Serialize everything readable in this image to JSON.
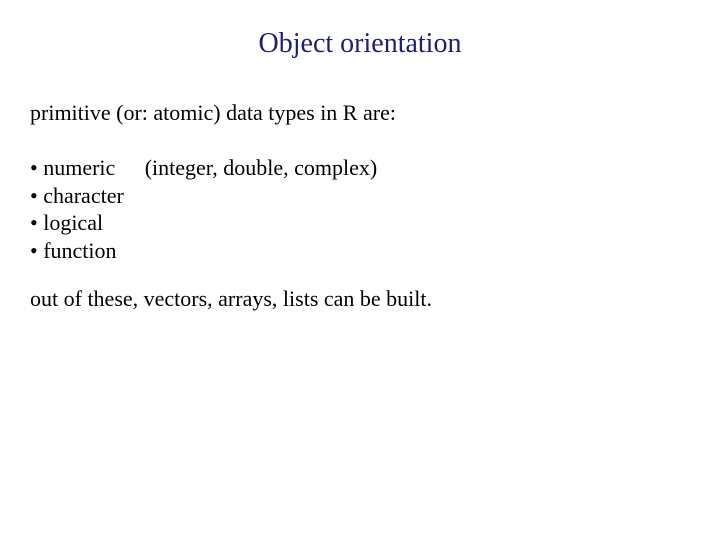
{
  "title": "Object orientation",
  "intro": "primitive (or: atomic) data types in R are:",
  "items": {
    "0": {
      "label": "numeric",
      "note": "(integer, double, complex)"
    },
    "1": {
      "label": "character",
      "note": ""
    },
    "2": {
      "label": "logical",
      "note": ""
    },
    "3": {
      "label": "function",
      "note": ""
    }
  },
  "outro": "out of these, vectors, arrays, lists can be built."
}
